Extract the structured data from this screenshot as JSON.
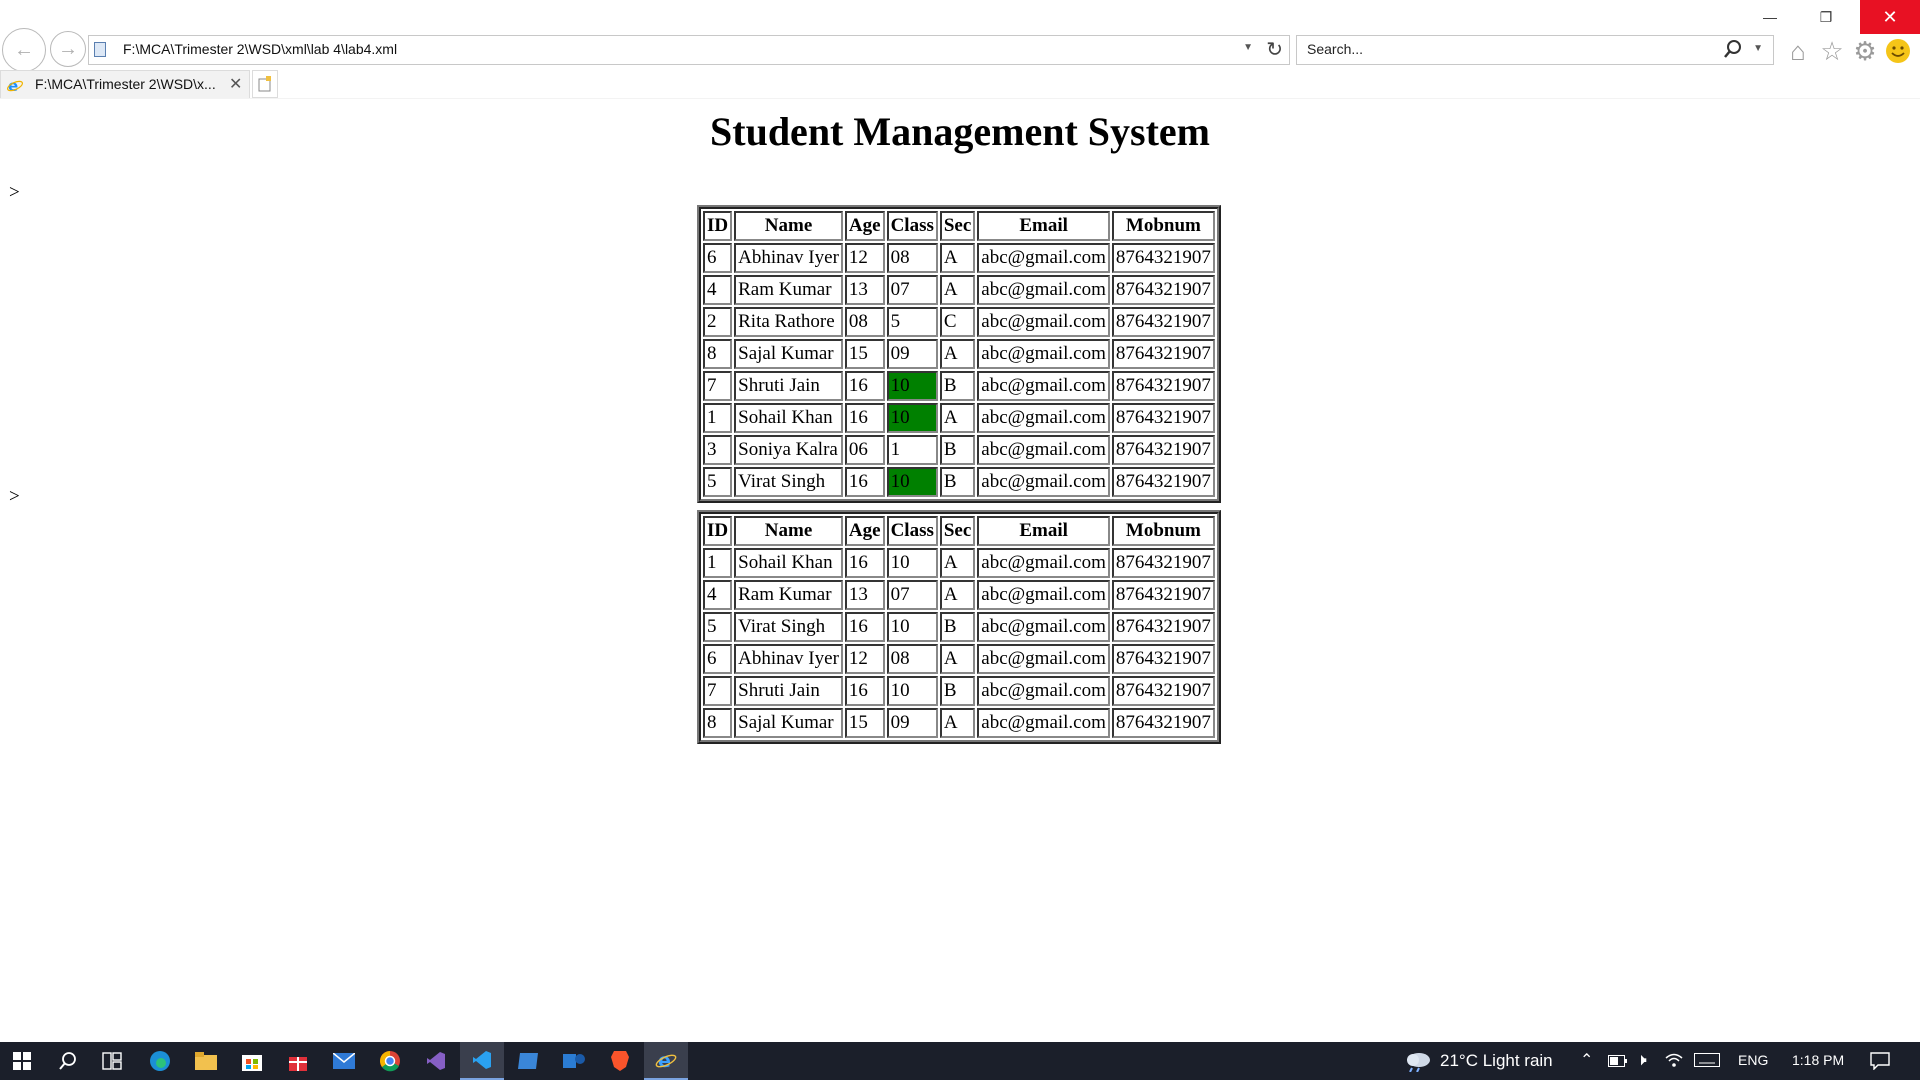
{
  "browser": {
    "address": "F:\\MCA\\Trimester 2\\WSD\\xml\\lab 4\\lab4.xml",
    "search_placeholder": "Search...",
    "tab_title": "F:\\MCA\\Trimester 2\\WSD\\x...",
    "icons": [
      "back-icon",
      "forward-icon",
      "page-icon",
      "dropdown-icon",
      "refresh-icon",
      "search-icon",
      "home-icon",
      "star-icon",
      "gear-icon",
      "smiley-icon",
      "ie-icon",
      "close-icon",
      "new-tab-icon"
    ]
  },
  "page": {
    "title": "Student Management System",
    "marker_1": ">",
    "marker_2": ">",
    "highlight_color": "#008000",
    "columns": [
      "ID",
      "Name",
      "Age",
      "Class",
      "Sec",
      "Email",
      "Mobnum"
    ],
    "table1": [
      {
        "id": "6",
        "name": "Abhinav Iyer",
        "age": "12",
        "class": "08",
        "sec": "A",
        "email": "abc@gmail.com",
        "mob": "8764321907",
        "highlight": false
      },
      {
        "id": "4",
        "name": "Ram Kumar",
        "age": "13",
        "class": "07",
        "sec": "A",
        "email": "abc@gmail.com",
        "mob": "8764321907",
        "highlight": false
      },
      {
        "id": "2",
        "name": "Rita Rathore",
        "age": "08",
        "class": "5",
        "sec": "C",
        "email": "abc@gmail.com",
        "mob": "8764321907",
        "highlight": false
      },
      {
        "id": "8",
        "name": "Sajal Kumar",
        "age": "15",
        "class": "09",
        "sec": "A",
        "email": "abc@gmail.com",
        "mob": "8764321907",
        "highlight": false
      },
      {
        "id": "7",
        "name": "Shruti Jain",
        "age": "16",
        "class": "10",
        "sec": "B",
        "email": "abc@gmail.com",
        "mob": "8764321907",
        "highlight": true
      },
      {
        "id": "1",
        "name": "Sohail Khan",
        "age": "16",
        "class": "10",
        "sec": "A",
        "email": "abc@gmail.com",
        "mob": "8764321907",
        "highlight": true
      },
      {
        "id": "3",
        "name": "Soniya Kalra",
        "age": "06",
        "class": "1",
        "sec": "B",
        "email": "abc@gmail.com",
        "mob": "8764321907",
        "highlight": false
      },
      {
        "id": "5",
        "name": "Virat Singh",
        "age": "16",
        "class": "10",
        "sec": "B",
        "email": "abc@gmail.com",
        "mob": "8764321907",
        "highlight": true
      }
    ],
    "table2": [
      {
        "id": "1",
        "name": "Sohail Khan",
        "age": "16",
        "class": "10",
        "sec": "A",
        "email": "abc@gmail.com",
        "mob": "8764321907"
      },
      {
        "id": "4",
        "name": "Ram Kumar",
        "age": "13",
        "class": "07",
        "sec": "A",
        "email": "abc@gmail.com",
        "mob": "8764321907"
      },
      {
        "id": "5",
        "name": "Virat Singh",
        "age": "16",
        "class": "10",
        "sec": "B",
        "email": "abc@gmail.com",
        "mob": "8764321907"
      },
      {
        "id": "6",
        "name": "Abhinav Iyer",
        "age": "12",
        "class": "08",
        "sec": "A",
        "email": "abc@gmail.com",
        "mob": "8764321907"
      },
      {
        "id": "7",
        "name": "Shruti Jain",
        "age": "16",
        "class": "10",
        "sec": "B",
        "email": "abc@gmail.com",
        "mob": "8764321907"
      },
      {
        "id": "8",
        "name": "Sajal Kumar",
        "age": "15",
        "class": "09",
        "sec": "A",
        "email": "abc@gmail.com",
        "mob": "8764321907"
      }
    ]
  },
  "taskbar": {
    "apps": [
      "windows-start-icon",
      "search-icon",
      "task-view-icon",
      "edge-icon",
      "file-explorer-icon",
      "store-icon",
      "gift-icon",
      "mail-icon",
      "chrome-icon",
      "visual-studio-icon",
      "vscode-icon",
      "app-icon",
      "teams-icon",
      "brave-icon",
      "internet-explorer-icon"
    ],
    "weather": "21°C  Light rain",
    "language": "ENG",
    "time": "1:18 PM"
  }
}
